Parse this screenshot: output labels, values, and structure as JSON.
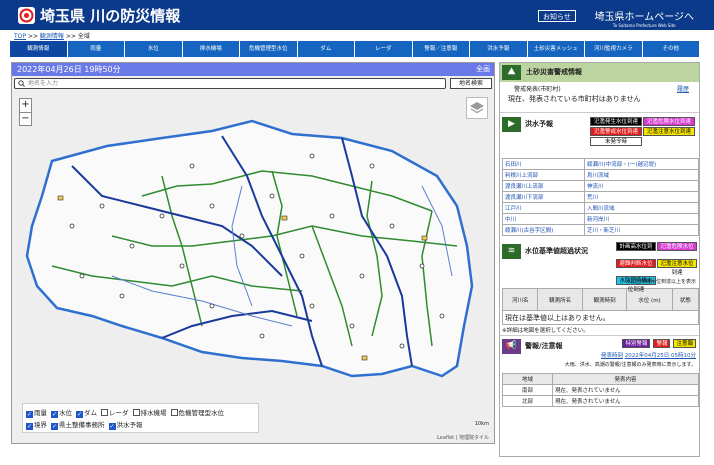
{
  "header": {
    "title": "埼玉県 川の防災情報",
    "notice_label": "お知らせ",
    "home_link": "埼玉県ホームページへ",
    "home_link_sub": "To Saitama Prefecture Web Site"
  },
  "breadcrumb": {
    "top": "TOP",
    "sep1": ">>",
    "obs": "観測情報",
    "sep2": ">>",
    "current": "全域"
  },
  "nav": {
    "items": [
      "観測情報",
      "雨量",
      "水位",
      "排水機場",
      "危機管理型水位",
      "ダム",
      "レーダ",
      "警報／注意報",
      "洪水予報",
      "土砂災害メッシュ",
      "河川監視カメラ",
      "その他"
    ]
  },
  "map": {
    "datetime": "2022年04月26日 19時50分",
    "all_area": "全画",
    "search_placeholder": "地名を入力",
    "search_button": "地名検索",
    "zoom_in": "+",
    "zoom_out": "−",
    "scale_label": "10km",
    "attribution": "Leaflet | 地理院タイル",
    "legend": [
      [
        {
          "label": "雨量",
          "checked": true
        },
        {
          "label": "水位",
          "checked": true
        },
        {
          "label": "ダム",
          "checked": true
        },
        {
          "label": "レーダ",
          "checked": false
        },
        {
          "label": "排水機場",
          "checked": false
        },
        {
          "label": "危機管理型水位",
          "checked": false
        }
      ],
      [
        {
          "label": "境界",
          "checked": true
        },
        {
          "label": "県土整備事務所",
          "checked": true
        },
        {
          "label": "洪水予報",
          "checked": true
        }
      ]
    ]
  },
  "landslide": {
    "title": "土砂災害警戒情報",
    "sub_label": "警戒発表(市町村)",
    "history_link": "履歴",
    "status": "現在、発表されている市町村はありません"
  },
  "flood": {
    "title": "洪水予報",
    "icon": "flood-forecast-icon",
    "tags": [
      {
        "label": "氾濫発生水位到達",
        "bg": "#000000",
        "fg": "#ffffff"
      },
      {
        "label": "氾濫危険水位到達",
        "bg": "#d63ad1",
        "fg": "#ffffff"
      },
      {
        "label": "氾濫警戒水位到達",
        "bg": "#e11d1d",
        "fg": "#ffffff"
      },
      {
        "label": "氾濫注意水位到達",
        "bg": "#f7e600",
        "fg": "#000000"
      },
      {
        "label": "未発令時",
        "bg": "#ffffff",
        "fg": "#000000"
      }
    ],
    "rivers": [
      [
        "石田川",
        "綾瀬川(中流部・(一)越辺堤)"
      ],
      [
        "利根川上流部",
        "烏川流域"
      ],
      [
        "渡良瀬川上流部",
        "神流川"
      ],
      [
        "渡良瀬川下流部",
        "荒川"
      ],
      [
        "江戸川",
        "入間川流域"
      ],
      [
        "中川",
        "新河岸川"
      ],
      [
        "綾瀬川(古谷字区間)",
        "芝川・新芝川"
      ]
    ]
  },
  "water_level": {
    "title": "水位基準値超過状況",
    "tags": [
      {
        "label": "計画高水位到達",
        "bg": "#000000",
        "fg": "#ffffff"
      },
      {
        "label": "氾濫危険水位到達",
        "bg": "#d63ad1",
        "fg": "#ffffff"
      },
      {
        "label": "避難判断水位到達",
        "bg": "#e11d1d",
        "fg": "#ffffff"
      },
      {
        "label": "氾濫注意水位到達",
        "bg": "#f7e600",
        "fg": "#000000"
      },
      {
        "label": "水防団待機水位到達",
        "bg": "#22c4e6",
        "fg": "#000000"
      }
    ],
    "note": "水防団待機水位到達以上を表示",
    "columns": [
      "河川名",
      "観測所名",
      "観測時刻",
      "水位 (m)",
      "状態"
    ],
    "status": "現在は基準値以上はありません。",
    "footnote": "※詳細は地図を選択してください。"
  },
  "warnings": {
    "title": "警報/注意報",
    "tags": [
      {
        "label": "特別警報",
        "bg": "#6a1b9a",
        "fg": "#ffffff"
      },
      {
        "label": "警報",
        "bg": "#e11d1d",
        "fg": "#ffffff"
      },
      {
        "label": "注意報",
        "bg": "#f7e600",
        "fg": "#000000"
      }
    ],
    "issued_prefix": "発表時刻",
    "issued": "2022年04月25日 05時10分",
    "desc": "大雨、洪水、高潮の警報/注意報のみ発表時に表示します。",
    "columns": [
      "地域",
      "発表内容"
    ],
    "rows": [
      {
        "area": "南部",
        "content": "現在、発表されていません"
      },
      {
        "area": "北部",
        "content": "現在、発表されていません"
      }
    ]
  }
}
